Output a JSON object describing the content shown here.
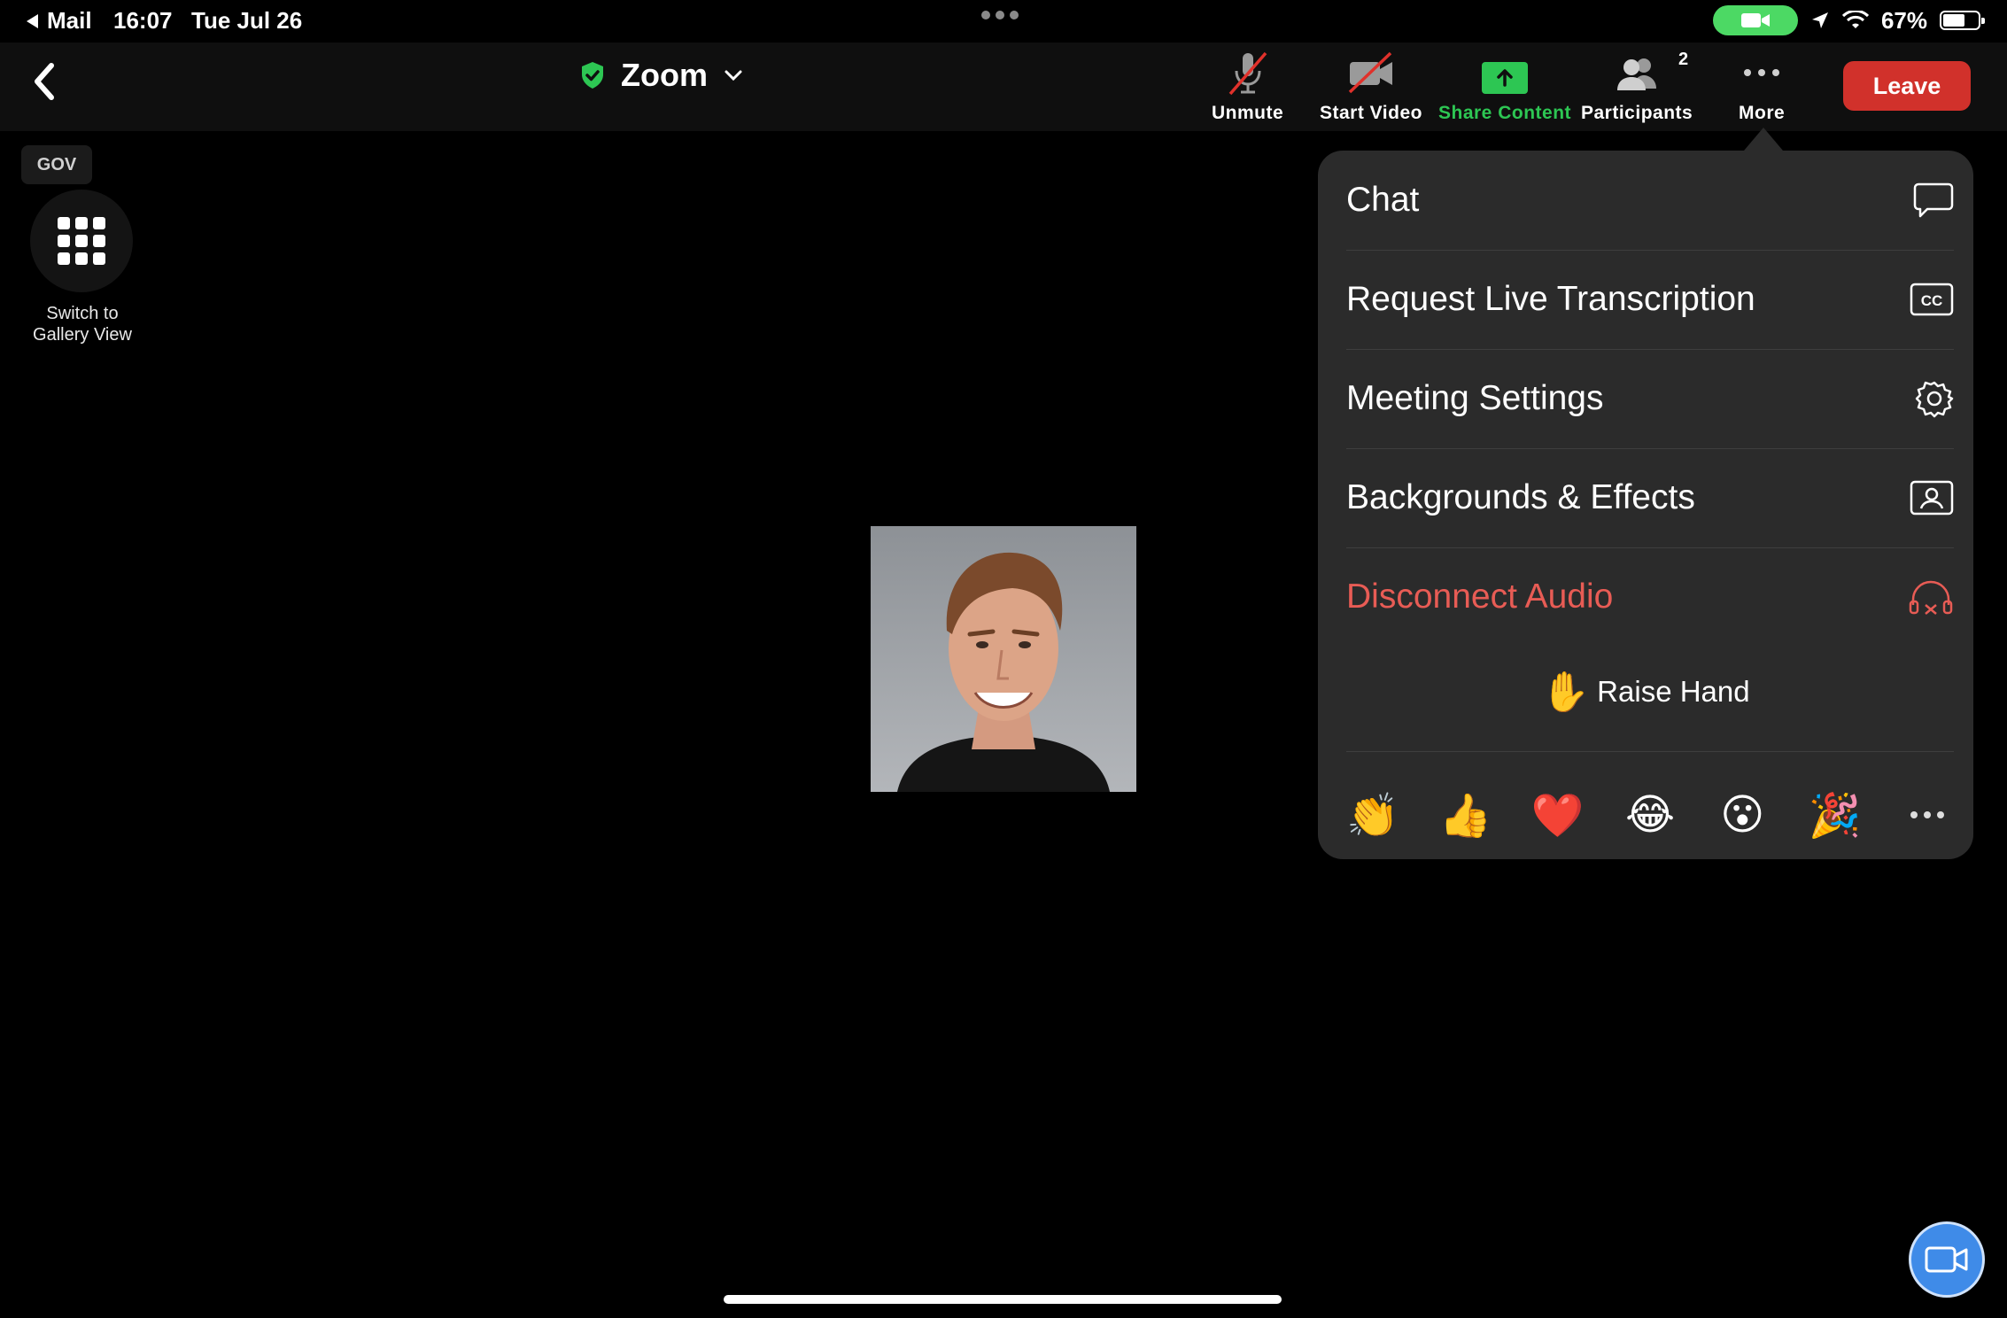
{
  "status_bar": {
    "back_app": "Mail",
    "time": "16:07",
    "date": "Tue Jul 26",
    "battery": "67%",
    "battery_level": 0.67
  },
  "toolbar": {
    "title": "Zoom",
    "unmute": "Unmute",
    "start_video": "Start Video",
    "share_content": "Share Content",
    "participants": "Participants",
    "participants_count": "2",
    "more": "More",
    "leave": "Leave"
  },
  "sidebar": {
    "badge": "GOV",
    "gallery_line1": "Switch to",
    "gallery_line2": "Gallery View"
  },
  "more_menu": {
    "items": [
      {
        "label": "Chat",
        "icon": "chat-bubble-icon"
      },
      {
        "label": "Request Live Transcription",
        "icon": "cc-icon"
      },
      {
        "label": "Meeting Settings",
        "icon": "gear-icon"
      },
      {
        "label": "Backgrounds & Effects",
        "icon": "person-frame-icon"
      },
      {
        "label": "Disconnect Audio",
        "icon": "headphones-disconnect-icon"
      }
    ],
    "raise_hand_emoji": "✋",
    "raise_hand": "Raise Hand",
    "reactions": [
      "👏",
      "👍",
      "❤️",
      "😂",
      "😮",
      "🎉"
    ]
  },
  "colors": {
    "accent_green": "#2dc653",
    "leave_red": "#d1312b",
    "danger_text": "#e85c55",
    "menu_bg": "#2b2b2b",
    "fab_blue": "#3f8be8"
  }
}
